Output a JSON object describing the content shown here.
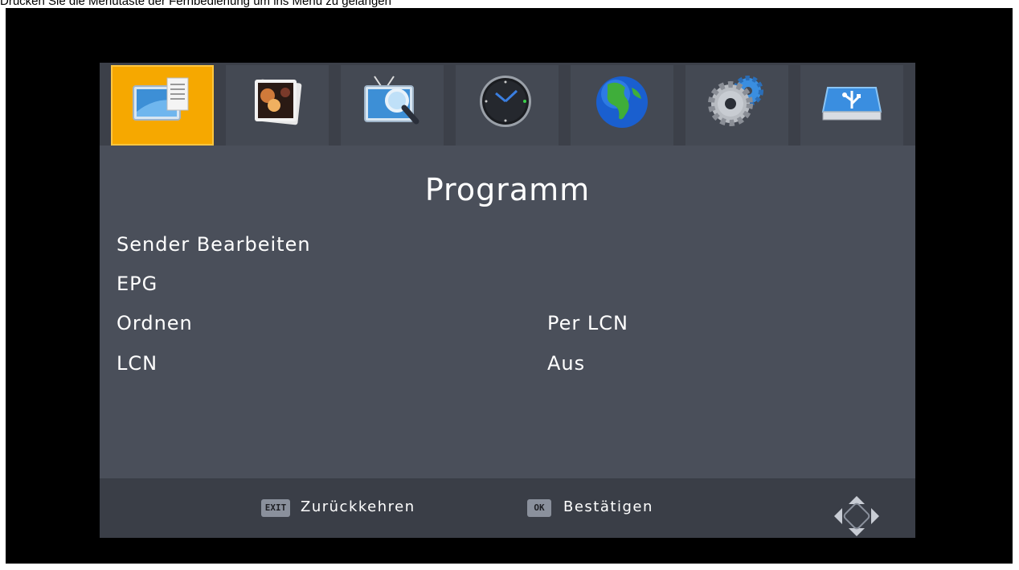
{
  "caption": "Drücken Sie die Menütaste der Fernbedienung um ins Menü zu gelangen",
  "tabs": [
    {
      "icon": "program-icon",
      "active": true
    },
    {
      "icon": "picture-icon",
      "active": false
    },
    {
      "icon": "tv-search-icon",
      "active": false
    },
    {
      "icon": "clock-icon",
      "active": false
    },
    {
      "icon": "globe-icon",
      "active": false
    },
    {
      "icon": "settings-gears-icon",
      "active": false
    },
    {
      "icon": "usb-drive-icon",
      "active": false
    }
  ],
  "title": "Programm",
  "menu": [
    {
      "label": "Sender Bearbeiten",
      "value": ""
    },
    {
      "label": "EPG",
      "value": ""
    },
    {
      "label": "Ordnen",
      "value": "Per LCN"
    },
    {
      "label": "LCN",
      "value": "Aus"
    }
  ],
  "footer": {
    "exit_key": "EXIT",
    "exit_label": "Zurückkehren",
    "ok_key": "OK",
    "ok_label": "Bestätigen"
  },
  "colors": {
    "accent": "#f6a800",
    "panel": "#4a4f5a",
    "background": "#000000"
  }
}
